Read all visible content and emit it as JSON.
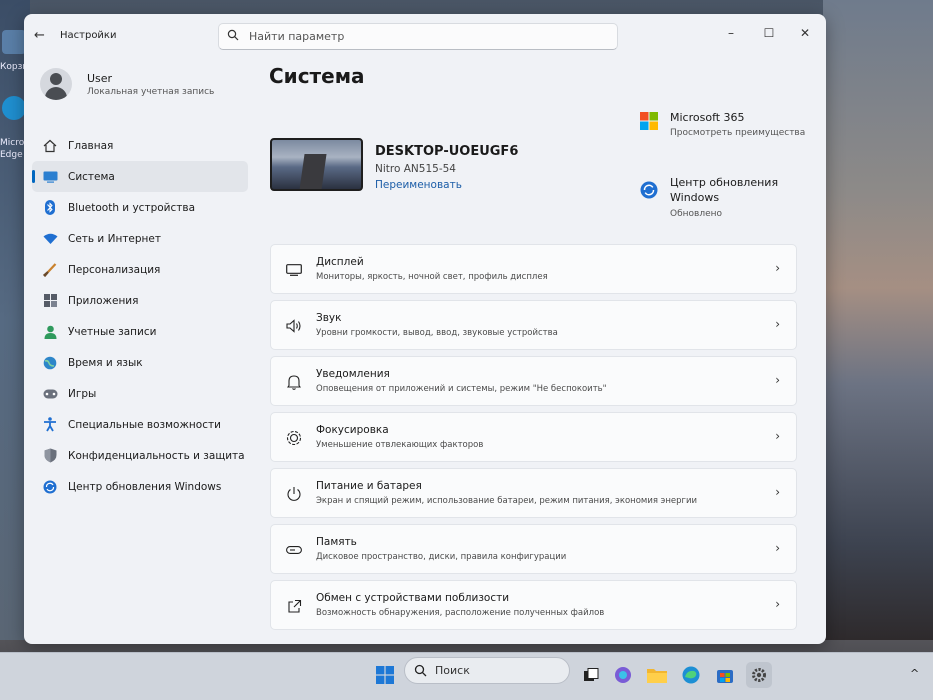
{
  "desktop": {
    "labels": [
      "Корзи",
      "Micros",
      "Edge"
    ]
  },
  "window": {
    "app_title": "Настройки",
    "back_icon": "back-arrow-icon",
    "search_placeholder": "Найти параметр",
    "controls": [
      "minimize-icon",
      "maximize-icon",
      "close-icon"
    ]
  },
  "user": {
    "name": "User",
    "account_type": "Локальная учетная запись"
  },
  "sidebar": {
    "items": [
      {
        "label": "Главная",
        "icon": "home-icon",
        "active": false
      },
      {
        "label": "Система",
        "icon": "system-icon",
        "active": true
      },
      {
        "label": "Bluetooth и устройства",
        "icon": "bluetooth-icon",
        "active": false
      },
      {
        "label": "Сеть и Интернет",
        "icon": "wifi-icon",
        "active": false
      },
      {
        "label": "Персонализация",
        "icon": "brush-icon",
        "active": false
      },
      {
        "label": "Приложения",
        "icon": "apps-icon",
        "active": false
      },
      {
        "label": "Учетные записи",
        "icon": "accounts-icon",
        "active": false
      },
      {
        "label": "Время и язык",
        "icon": "time-language-icon",
        "active": false
      },
      {
        "label": "Игры",
        "icon": "gamepad-icon",
        "active": false
      },
      {
        "label": "Специальные возможности",
        "icon": "accessibility-icon",
        "active": false
      },
      {
        "label": "Конфиденциальность и защита",
        "icon": "shield-icon",
        "active": false
      },
      {
        "label": "Центр обновления Windows",
        "icon": "update-icon",
        "active": false
      }
    ]
  },
  "main": {
    "title": "Система",
    "device": {
      "name": "DESKTOP-UOEUGF6",
      "model": "Nitro AN515-54",
      "rename_label": "Переименовать"
    },
    "promos": [
      {
        "title": "Microsoft 365",
        "subtitle": "Просмотреть преимущества",
        "icon": "microsoft-logo-icon"
      },
      {
        "title": "Центр обновления Windows",
        "subtitle": "Обновлено",
        "icon": "windows-update-icon"
      }
    ],
    "cards": [
      {
        "title": "Дисплей",
        "subtitle": "Мониторы, яркость, ночной свет, профиль дисплея",
        "icon": "display-icon"
      },
      {
        "title": "Звук",
        "subtitle": "Уровни громкости, вывод, ввод, звуковые устройства",
        "icon": "speaker-icon"
      },
      {
        "title": "Уведомления",
        "subtitle": "Оповещения от приложений и системы, режим \"Не беспокоить\"",
        "icon": "bell-icon"
      },
      {
        "title": "Фокусировка",
        "subtitle": "Уменьшение отвлекающих факторов",
        "icon": "focus-icon"
      },
      {
        "title": "Питание и батарея",
        "subtitle": "Экран и спящий режим, использование батареи, режим питания, экономия энергии",
        "icon": "power-icon"
      },
      {
        "title": "Память",
        "subtitle": "Дисковое пространство, диски, правила конфигурации",
        "icon": "storage-icon"
      },
      {
        "title": "Обмен с устройствами поблизости",
        "subtitle": "Возможность обнаружения, расположение полученных файлов",
        "icon": "share-icon"
      }
    ]
  },
  "taskbar": {
    "search_label": "Поиск",
    "tray_chevron": "^"
  },
  "colors": {
    "accent": "#0067c0",
    "link": "#1d5ea8",
    "window_bg": "#f0f2f6"
  }
}
